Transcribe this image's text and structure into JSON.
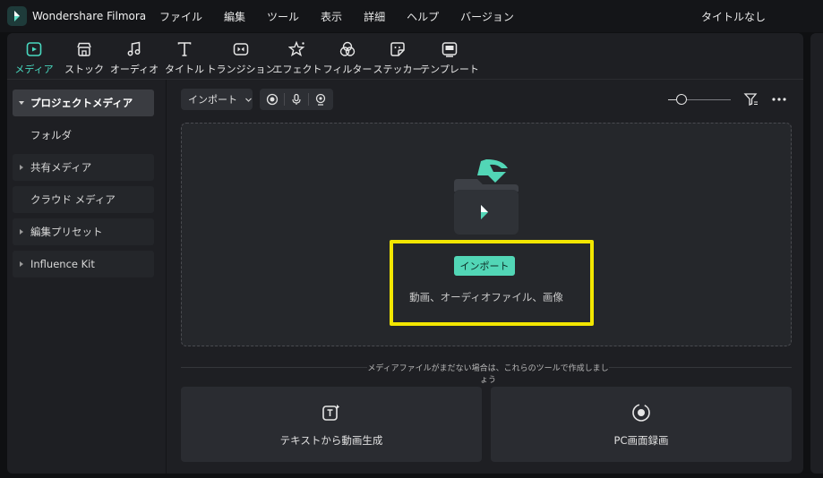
{
  "app": {
    "name": "Wondershare Filmora",
    "doc_title": "タイトルなし"
  },
  "menu": [
    "ファイル",
    "編集",
    "ツール",
    "表示",
    "詳細",
    "ヘルプ",
    "バージョン"
  ],
  "tabs": [
    {
      "label": "メディア",
      "icon": "media-icon",
      "active": true
    },
    {
      "label": "ストック",
      "icon": "stock-icon"
    },
    {
      "label": "オーディオ",
      "icon": "audio-icon"
    },
    {
      "label": "タイトル",
      "icon": "title-icon"
    },
    {
      "label": "トランジション",
      "icon": "transition-icon"
    },
    {
      "label": "エフェクト",
      "icon": "effect-icon"
    },
    {
      "label": "フィルター",
      "icon": "filter-icon"
    },
    {
      "label": "ステッカー",
      "icon": "sticker-icon"
    },
    {
      "label": "テンプレート",
      "icon": "template-icon"
    }
  ],
  "sidebar": {
    "items": [
      {
        "label": "プロジェクトメディア",
        "caret": true,
        "active": true
      },
      {
        "label": "フォルダ",
        "caret": false,
        "plain": true
      },
      {
        "label": "共有メディア",
        "caret": true
      },
      {
        "label": "クラウド メディア",
        "caret": false
      },
      {
        "label": "編集プリセット",
        "caret": true
      },
      {
        "label": "Influence Kit",
        "caret": true
      }
    ]
  },
  "toolbar": {
    "import_label": "インポート",
    "zoom_level": 0.1
  },
  "dropzone": {
    "import_button": "インポート",
    "hint": "動画、オーディオファイル、画像"
  },
  "tools_section": {
    "caption": "メディアファイルがまだない場合は、これらのツールで作成しましょう",
    "cards": [
      {
        "label": "テキストから動画生成",
        "icon": "text-to-video-icon"
      },
      {
        "label": "PC画面録画",
        "icon": "screen-record-icon"
      }
    ]
  },
  "colors": {
    "accent": "#48d8bf",
    "highlight": "#f2e600",
    "import_button": "#52d6b6"
  }
}
